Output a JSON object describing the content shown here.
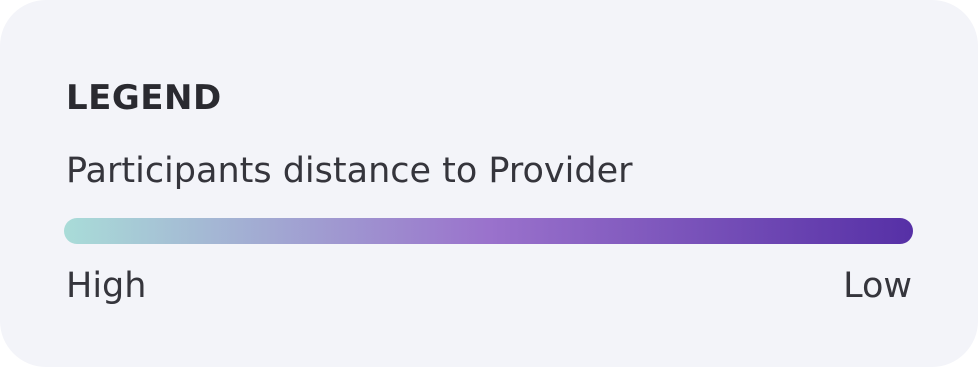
{
  "legend": {
    "title": "LEGEND",
    "subtitle": "Participants distance to Provider",
    "scale": {
      "start_label": "High",
      "end_label": "Low",
      "start_color": "#a9dcd8",
      "mid_color": "#9a72cc",
      "end_color": "#5630a6"
    }
  },
  "colors": {
    "card_background": "#f3f4f9",
    "text": "#35353c"
  }
}
